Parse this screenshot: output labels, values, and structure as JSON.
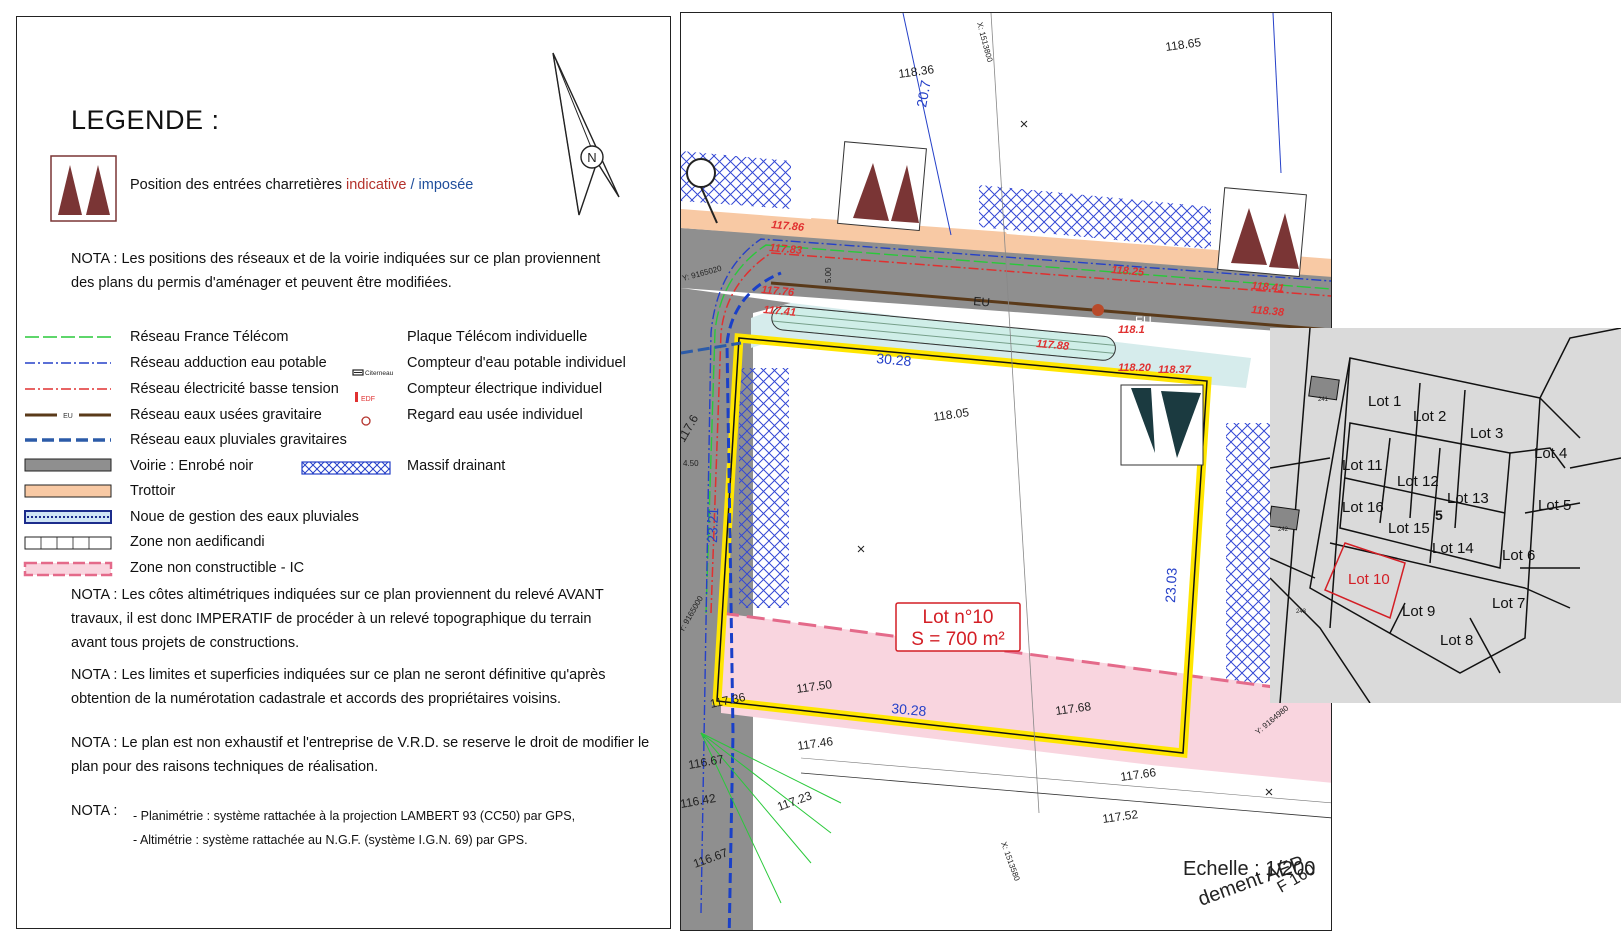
{
  "legend": {
    "title": "LEGENDE :",
    "entrance": {
      "text": "Position des entrées charretières ",
      "indicative": "indicative",
      "sep": " / ",
      "imposed": "imposée"
    },
    "nota1": [
      "NOTA : Les positions des réseaux et de la voirie indiquées sur ce plan proviennent",
      "des plans du permis d'aménager et peuvent être modifiées."
    ],
    "items_left": [
      "Réseau France Télécom",
      "Réseau adduction eau potable",
      "Réseau électricité basse tension",
      "Réseau eaux usées gravitaire",
      "Réseau eaux pluviales gravitaires",
      "Voirie : Enrobé noir",
      "Trottoir",
      "Noue de gestion des eaux pluviales",
      "Zone non aedificandi",
      "Zone non constructible - IC"
    ],
    "items_right": [
      "Plaque Télécom individuelle",
      "Compteur d'eau potable individuel",
      "Compteur électrique individuel",
      "Regard eau usée individuel",
      "Massif drainant"
    ],
    "symbol_labels": {
      "eu": "EU",
      "citerneau": "Citerneau",
      "edf": "EDF"
    },
    "nota2": [
      "NOTA : Les côtes altimétriques indiquées sur ce plan proviennent du relevé AVANT",
      "travaux, il est donc IMPERATIF de procéder à un relevé topographique du terrain",
      "avant tous projets de constructions."
    ],
    "nota3": [
      "NOTA : Les limites et superficies indiquées sur ce plan ne seront définitive qu'après",
      "obtention de la numérotation cadastrale et accords des propriétaires voisins."
    ],
    "nota4": [
      "NOTA : Le plan est non exhaustif et l'entreprise de V.R.D. se reserve le droit de modifier le",
      " plan pour des raisons techniques de réalisation."
    ],
    "nota5_label": "NOTA :",
    "nota5": [
      "- Planimétrie : système rattachée à la projection LAMBERT 93 (CC50) par GPS,",
      "- Altimétrie : système rattachée au N.G.F. (système I.G.N. 69) par GPS."
    ]
  },
  "north": "N",
  "plan": {
    "lot_title": "Lot n°10",
    "lot_area": "S = 700 m²",
    "scale": "Echelle : 1/200",
    "scale_overlay": "dement AEP",
    "scale_overlay2": "F 160",
    "dims": {
      "top": "30.28",
      "bottom": "30.28",
      "left": "23.21",
      "right": "23.03",
      "road_width": "5.00",
      "offset": "4.50"
    },
    "levels_black": [
      "118.65",
      "118.36",
      "118.05",
      "117.6",
      "117.50",
      "117.68",
      "117.36",
      "116.67",
      "117.46",
      "117.66",
      "117.52",
      "116.42",
      "117.23",
      "116.67"
    ],
    "levels_red": [
      "117.86",
      "117.83",
      "117.76",
      "117.41",
      "118.25",
      "118.41",
      "118.38",
      "117.88",
      "118.20",
      "118.37",
      "118.1"
    ],
    "coords": [
      "X: 1513800",
      "Y: 9165020",
      "Y: 9165000",
      "Y: 9164980",
      "X: 1513580"
    ],
    "labels": {
      "eu": "EU",
      "v205": "20.7"
    }
  },
  "inset": {
    "lots": [
      "Lot 1",
      "Lot 2",
      "Lot 3",
      "Lot 4",
      "Lot 5",
      "Lot 6",
      "Lot 7",
      "Lot 8",
      "Lot 9",
      "Lot 10",
      "Lot 11",
      "Lot 12",
      "Lot 13",
      "Lot 14",
      "Lot 15",
      "Lot 16"
    ],
    "parcels": [
      "241",
      "242",
      "243"
    ],
    "center": "5"
  },
  "colors": {
    "yellow": "#ffe600",
    "brown": "#7a3535",
    "road": "#8f8f8f",
    "sidewalk": "#f8c9a4",
    "pink": "#f9d5df",
    "lot_red": "#d31e25"
  }
}
